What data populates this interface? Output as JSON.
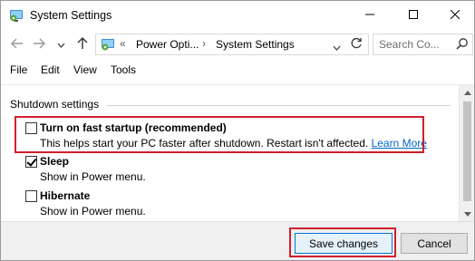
{
  "window": {
    "title": "System Settings"
  },
  "address_bar": {
    "prefix": "«",
    "crumbs": [
      "Power Opti...",
      "System Settings"
    ]
  },
  "search": {
    "placeholder": "Search Co..."
  },
  "menu": {
    "items": [
      "File",
      "Edit",
      "View",
      "Tools"
    ]
  },
  "section": {
    "title": "Shutdown settings"
  },
  "options": [
    {
      "label": "Turn on fast startup (recommended)",
      "description": "This helps start your PC faster after shutdown. Restart isn't affected.",
      "link": "Learn More",
      "checked": false
    },
    {
      "label": "Sleep",
      "description": "Show in Power menu.",
      "checked": true
    },
    {
      "label": "Hibernate",
      "description": "Show in Power menu.",
      "checked": false
    }
  ],
  "buttons": {
    "save": "Save changes",
    "cancel": "Cancel"
  },
  "colors": {
    "highlight": "#d0202c",
    "link": "#0066cc",
    "primary_border": "#0078d7"
  },
  "icons": [
    "control-panel-icon",
    "minimize-icon",
    "maximize-icon",
    "close-icon",
    "back-arrow-icon",
    "forward-arrow-icon",
    "dropdown-icon",
    "up-arrow-icon",
    "refresh-icon",
    "search-icon"
  ]
}
